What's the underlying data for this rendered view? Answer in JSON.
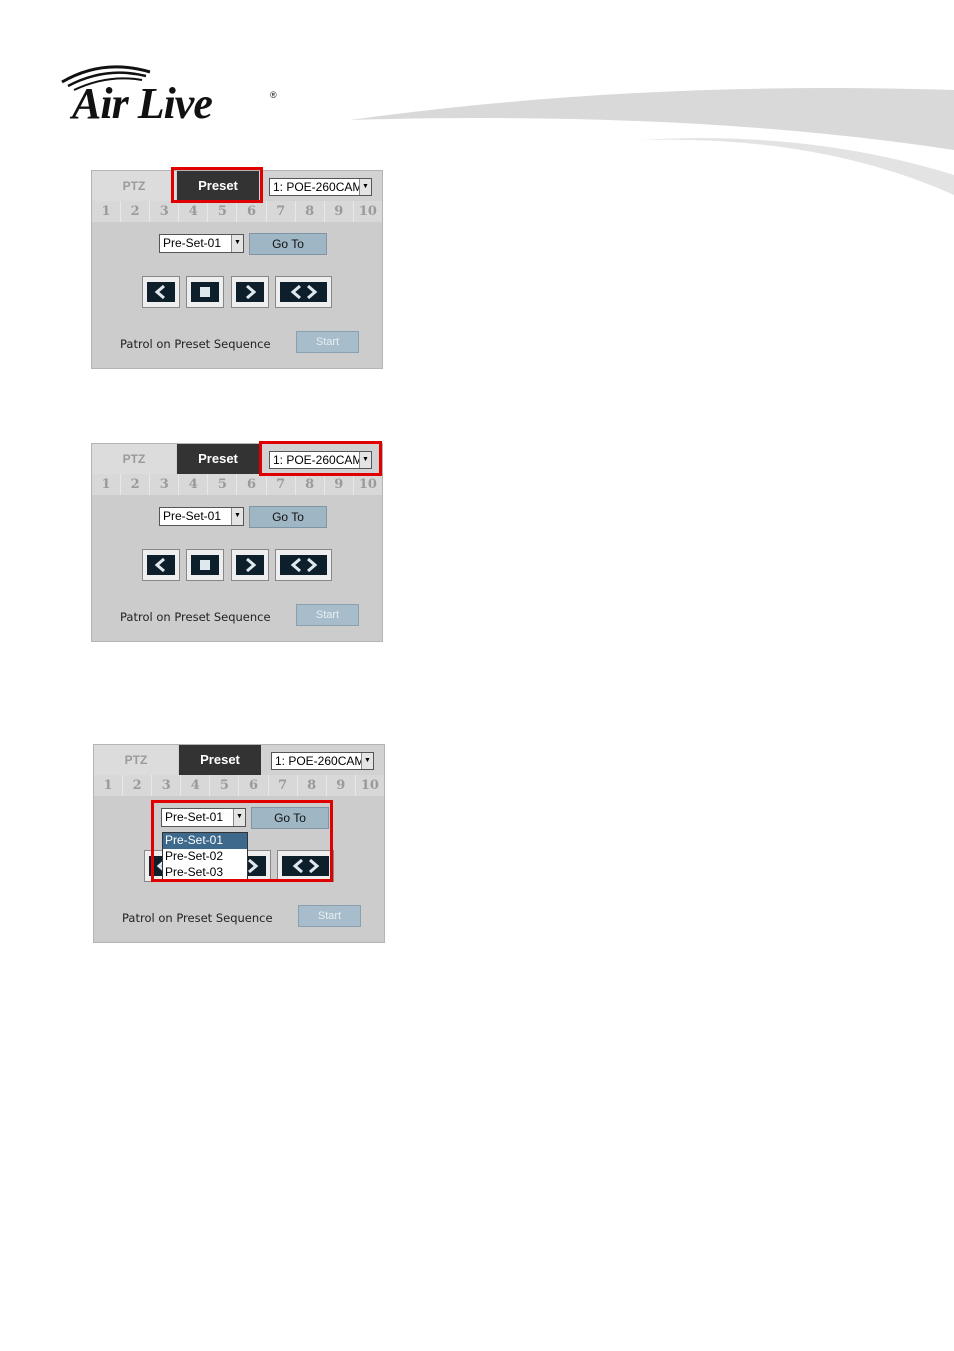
{
  "header": {
    "logo_text": "Air Live",
    "logo_mark": "®"
  },
  "panels": [
    {
      "tabs": {
        "ptz": "PTZ",
        "preset": "Preset"
      },
      "camera": "1: POE-260CAM",
      "numbers": [
        "1",
        "2",
        "3",
        "4",
        "5",
        "6",
        "7",
        "8",
        "9",
        "10"
      ],
      "preset_value": "Pre-Set-01",
      "goto_label": "Go To",
      "patrol_label": "Patrol on Preset Sequence",
      "start_label": "Start"
    },
    {
      "tabs": {
        "ptz": "PTZ",
        "preset": "Preset"
      },
      "camera": "1: POE-260CAM",
      "numbers": [
        "1",
        "2",
        "3",
        "4",
        "5",
        "6",
        "7",
        "8",
        "9",
        "10"
      ],
      "preset_value": "Pre-Set-01",
      "goto_label": "Go To",
      "patrol_label": "Patrol on Preset Sequence",
      "start_label": "Start"
    },
    {
      "tabs": {
        "ptz": "PTZ",
        "preset": "Preset"
      },
      "camera": "1: POE-260CAM",
      "numbers": [
        "1",
        "2",
        "3",
        "4",
        "5",
        "6",
        "7",
        "8",
        "9",
        "10"
      ],
      "preset_value": "Pre-Set-01",
      "goto_label": "Go To",
      "patrol_label": "Patrol on Preset Sequence",
      "start_label": "Start",
      "dropdown_options": [
        "Pre-Set-01",
        "Pre-Set-02",
        "Pre-Set-03"
      ]
    }
  ],
  "colors": {
    "highlight": "#e00000",
    "tab_active": "#333333",
    "panel_bg": "#cccccc",
    "button": "#9fb6c4"
  }
}
